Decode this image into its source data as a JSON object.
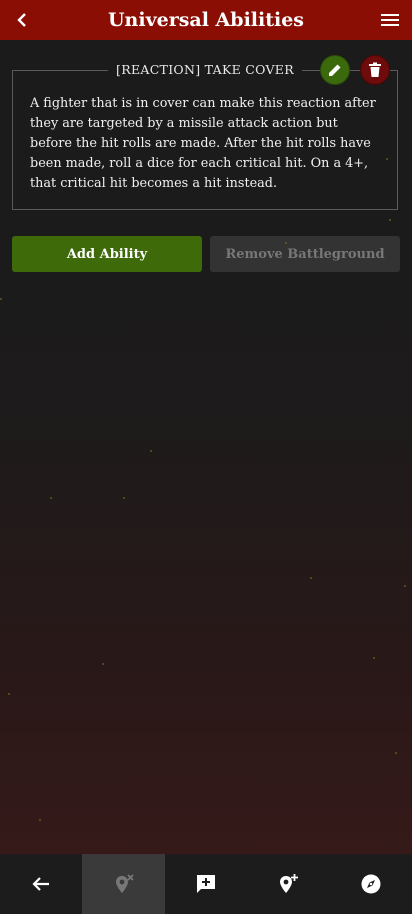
{
  "header": {
    "title": "Universal Abilities"
  },
  "ability": {
    "title": "[REACTION] TAKE COVER",
    "text": "A fighter that is in cover can make this reaction after they are targeted by a missile attack action but before the hit rolls are made. After the hit rolls have been made, roll a dice for each critical hit. On a 4+, that critical hit becomes a hit instead."
  },
  "actions": {
    "add_label": "Add Ability",
    "remove_label": "Remove Battleground"
  },
  "colors": {
    "header": "#8b0e04",
    "add": "#3e6a0a",
    "delete": "#6e0b0b"
  },
  "bottom_nav": [
    "back-arrow-icon",
    "remove-location-icon",
    "add-comment-icon",
    "add-location-icon",
    "compass-icon"
  ]
}
